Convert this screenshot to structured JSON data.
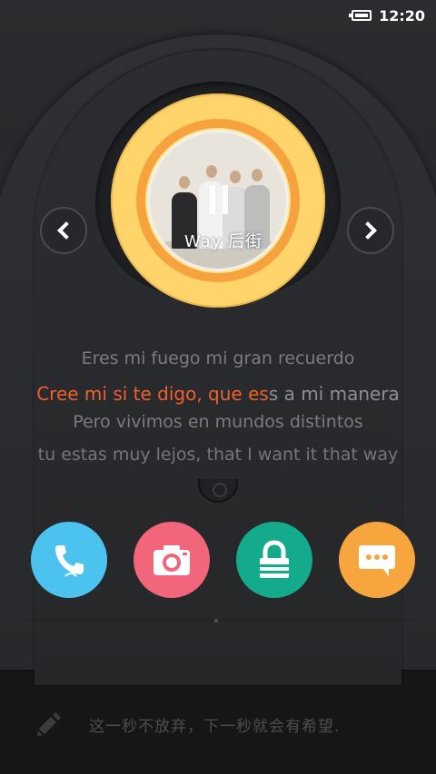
{
  "status_bar": {
    "time": "12:20",
    "battery_icon": "battery-icon"
  },
  "player": {
    "album_text": "Way 后街",
    "prev_icon": "chevron-left-icon",
    "next_icon": "chevron-right-icon"
  },
  "lyrics": {
    "line1": "Eres mi fuego mi gran recuerdo",
    "line2_played": "Cree mi si te digo, que es",
    "line2_rest": "s a mi manera",
    "line3": "Pero vivimos en mundos distintos",
    "line4": "tu estas muy lejos, that I want it that way"
  },
  "quick_launch": [
    {
      "name": "phone",
      "icon": "phone-icon",
      "color": "#4bc3ee"
    },
    {
      "name": "camera",
      "icon": "camera-icon",
      "color": "#f2657a"
    },
    {
      "name": "lock",
      "icon": "lock-icon",
      "color": "#14ab8c"
    },
    {
      "name": "message",
      "icon": "message-icon",
      "color": "#f7a63d"
    }
  ],
  "motto": {
    "icon": "pencil-icon",
    "text": "这一秒不放弃，下一秒就会有希望."
  },
  "colors": {
    "lyric_highlight": "#f0602d",
    "disc_yellow": "#ffd46a",
    "disc_orange": "#f6a23e"
  }
}
